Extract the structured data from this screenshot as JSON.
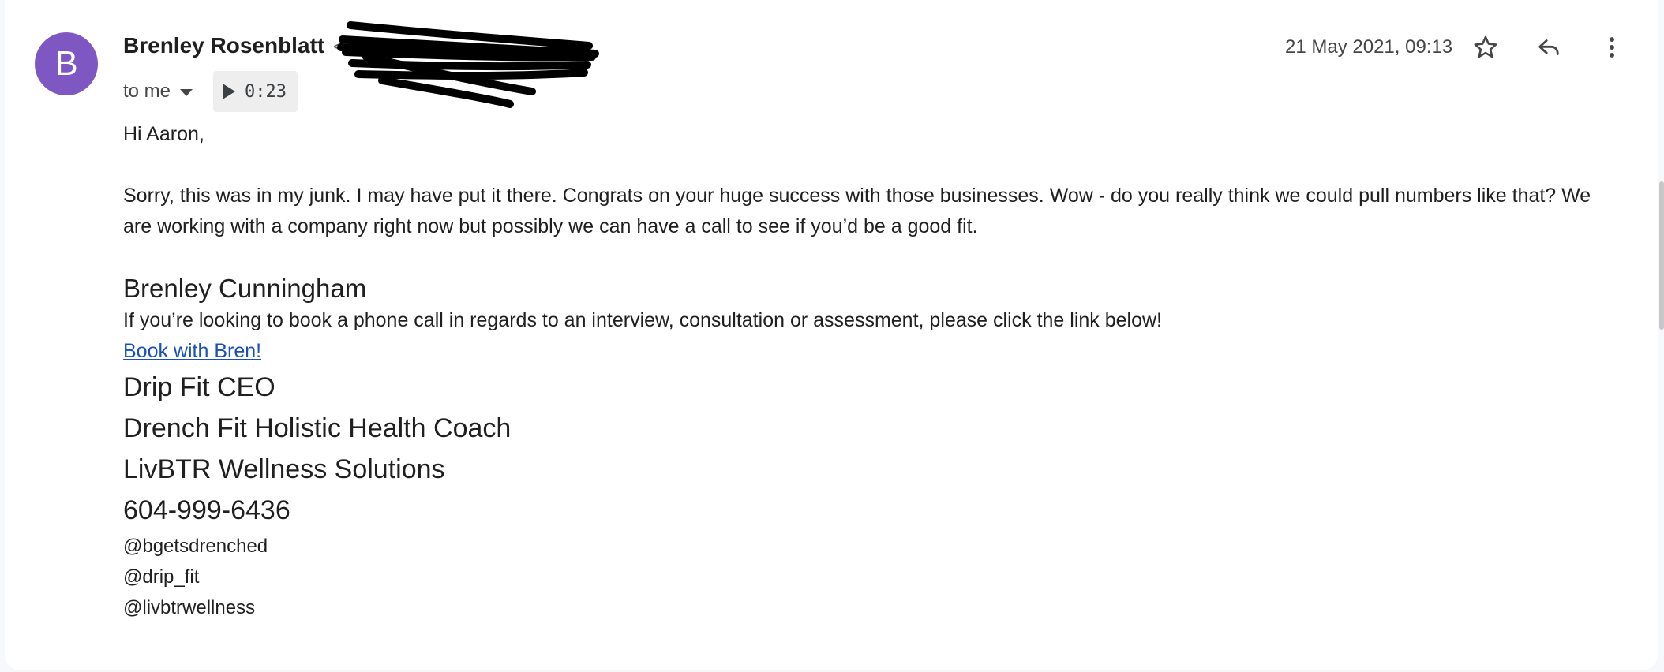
{
  "header": {
    "avatar_letter": "B",
    "sender_name": "Brenley Rosenblatt",
    "sender_email_fragment": "<",
    "recipient": "to me",
    "audio_duration": "0:23",
    "timestamp": "21 May 2021, 09:13"
  },
  "actions": {
    "star_icon": "star-outline",
    "reply_icon": "reply-arrow",
    "more_icon": "vertical-dots"
  },
  "body": {
    "greeting": "Hi Aaron,",
    "paragraph": "Sorry, this was in my junk. I may have put it there. Congrats on your huge success with those businesses. Wow - do you really think we could pull numbers like that? We are working with a company right now but possibly we can have a call to see if you’d be a good fit."
  },
  "signature": {
    "name": "Brenley Cunningham",
    "booking_text": "If you’re looking to book a phone call in regards to an interview, consultation or assessment, please click the link below!",
    "booking_link": "Book with Bren! ",
    "titles": [
      "Drip Fit CEO",
      "Drench Fit Holistic Health Coach",
      "LivBTR Wellness Solutions"
    ],
    "phone": "604-999-6436",
    "handles": [
      "@bgetsdrenched",
      "@drip_fit",
      "@livbtrwellness"
    ]
  },
  "colors": {
    "avatar_bg": "#7e57c2",
    "link": "#1a4fb6",
    "page_bg": "#f6f8fc"
  }
}
